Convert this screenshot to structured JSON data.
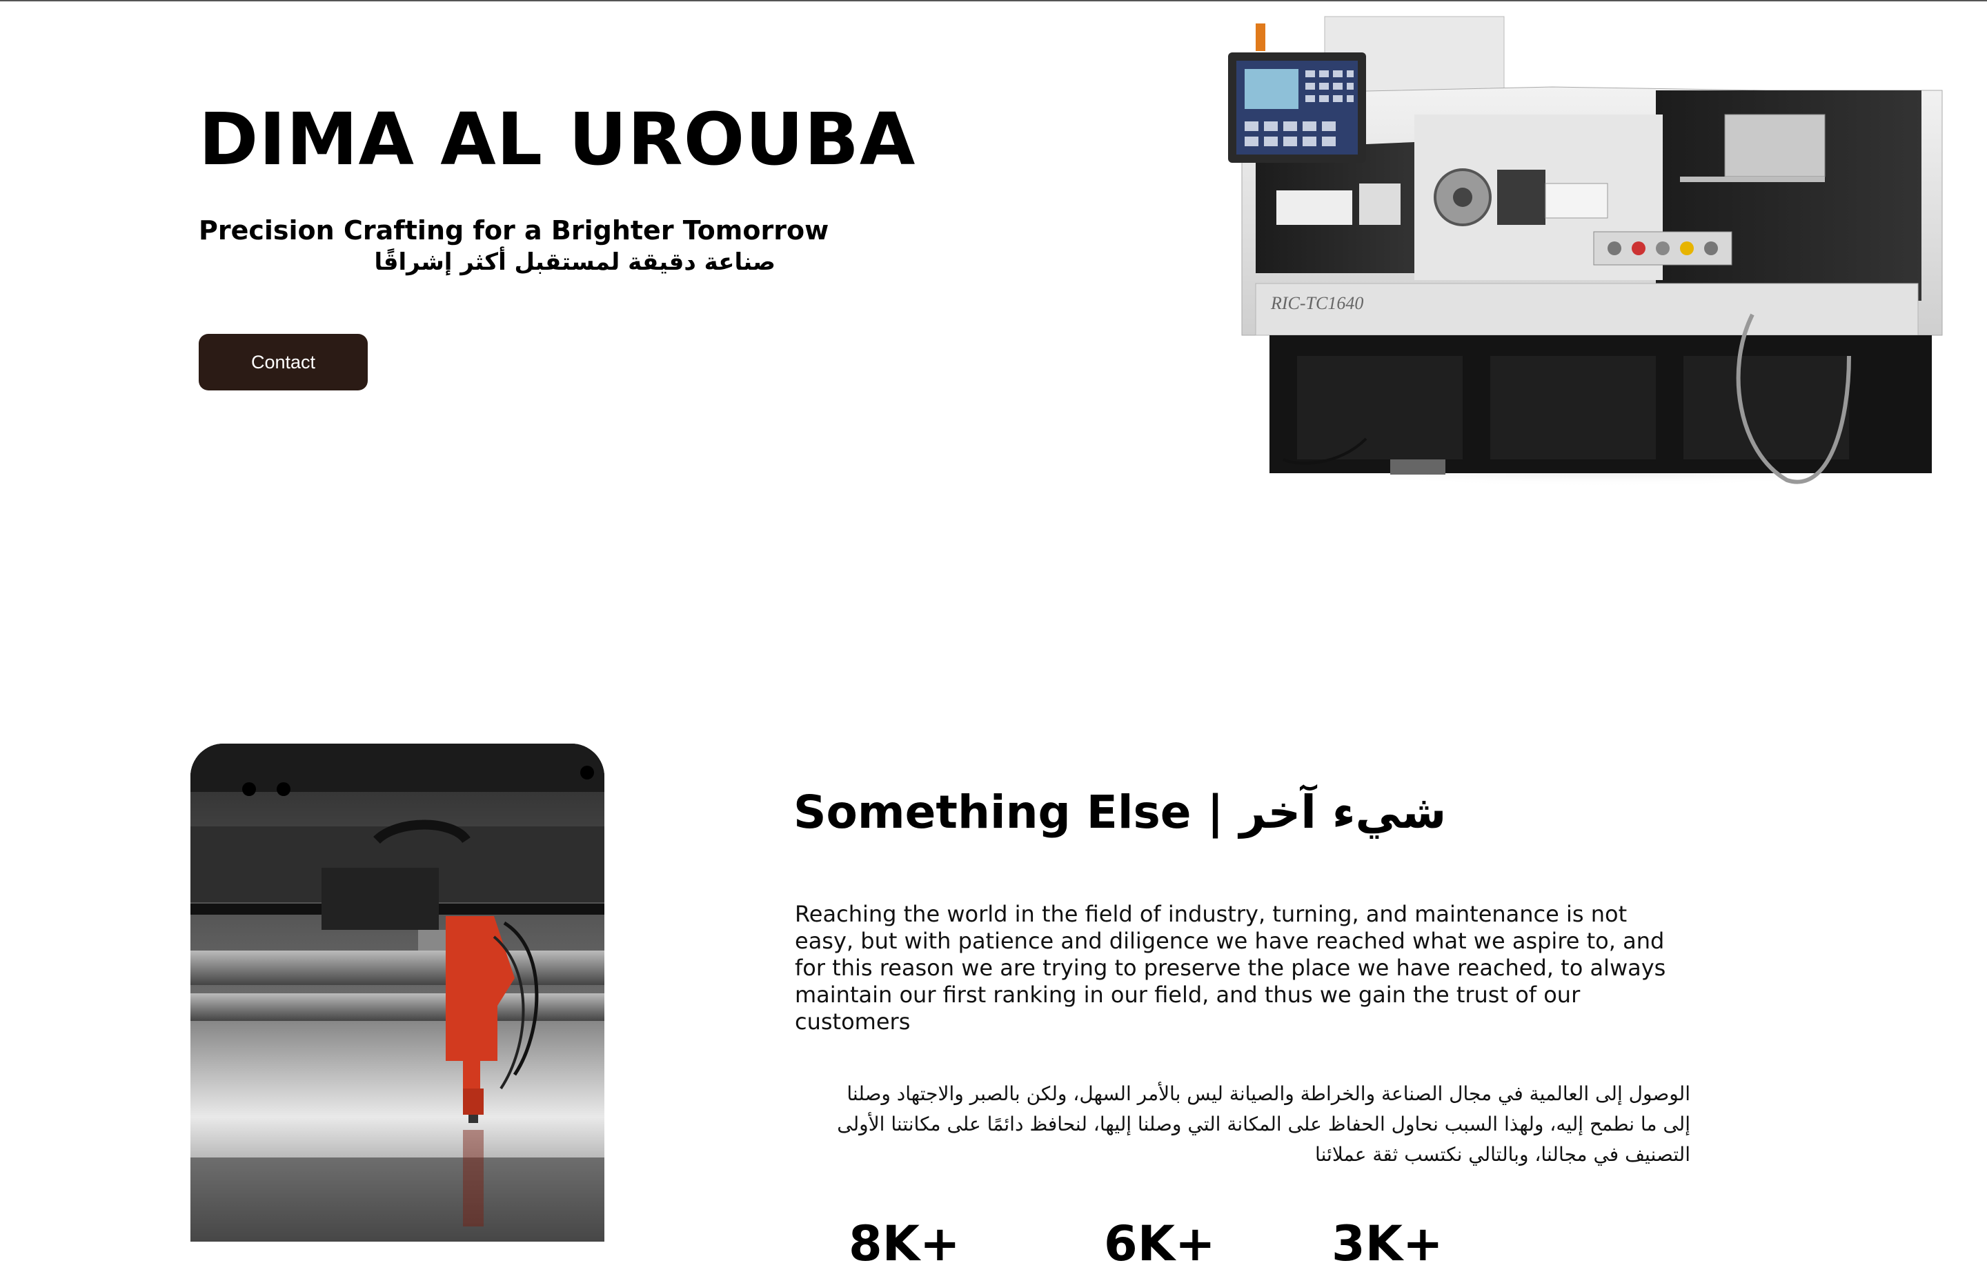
{
  "hero": {
    "brand": "DIMA AL UROUBA",
    "tagline_en": "Precision Crafting for a Brighter Tomorrow",
    "tagline_ar": "صناعة دقيقة لمستقبل أكثر إشراقًا",
    "contact_label": "Contact",
    "machine_model": "RIC-TC1640"
  },
  "about": {
    "title": "Something Else | شيء آخر",
    "paragraph_en": "Reaching the world in the field of industry, turning, and maintenance is not easy, but with patience and diligence we have reached what we aspire to, and for this reason we are trying to preserve the place we have reached, to always maintain our first ranking in our field, and thus we gain the trust of our customers",
    "paragraph_ar": "الوصول إلى العالمية في مجال الصناعة والخراطة والصيانة ليس بالأمر السهل، ولكن بالصبر والاجتهاد وصلنا إلى ما نطمح إليه، ولهذا السبب نحاول الحفاظ على المكانة التي وصلنا إليها، لنحافظ دائمًا على مكانتنا الأولى التصنيف في مجالنا، وبالتالي نكتسب ثقة عملائنا",
    "stats": [
      "8K+",
      "6K+",
      "3K+"
    ]
  },
  "colors": {
    "button_bg": "#2b1b15",
    "text": "#000000",
    "background": "#ffffff"
  }
}
